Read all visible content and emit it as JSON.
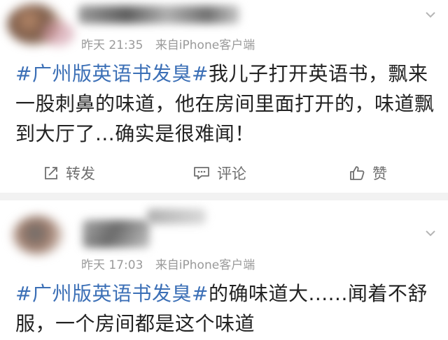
{
  "posts": [
    {
      "meta": {
        "time": "昨天 21:35",
        "source": "来自iPhone客户端"
      },
      "hashtag": "#广州版英语书发臭#",
      "body": "我儿子打开英语书，飘来一股刺鼻的味道，他在房间里面打开的，味道飘到大厅了...确实是很难闻！",
      "actions": {
        "repost": "转发",
        "comment": "评论",
        "like": "赞"
      }
    },
    {
      "meta": {
        "time": "昨天 17:03",
        "source": "来自iPhone客户端"
      },
      "hashtag": "#广州版英语书发臭#",
      "body": "的确味道大......闻着不舒服，一个房间都是这个味道"
    }
  ],
  "icons": {
    "repost": "repost-icon",
    "comment": "comment-icon",
    "like": "thumbs-up-icon",
    "menu": "chevron-down-icon"
  },
  "colors": {
    "hashtag": "#3b6fb6",
    "meta": "#9a9a9a",
    "divider": "#f2f2f2"
  }
}
